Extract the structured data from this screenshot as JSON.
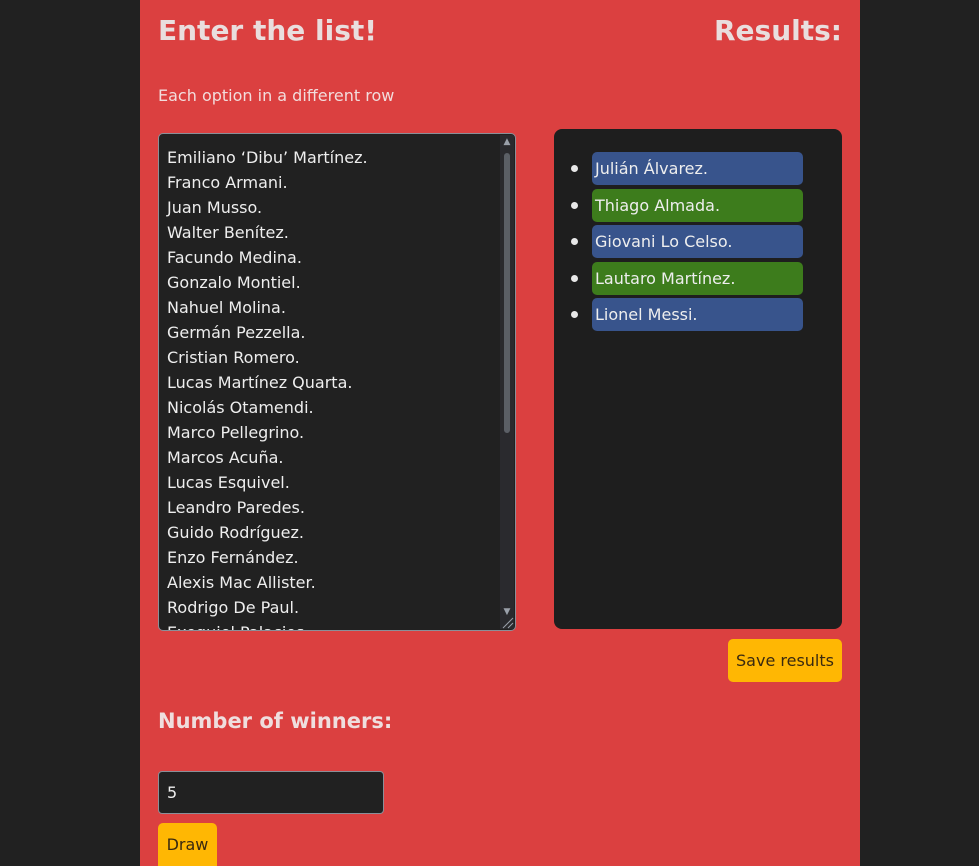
{
  "header": {
    "title": "Enter the list!",
    "results_title": "Results:"
  },
  "hint": "Each option in a different row",
  "options_list": [
    "Emiliano ‘Dibu’ Martínez.",
    "Franco Armani.",
    "Juan Musso.",
    "Walter Benítez.",
    "Facundo Medina.",
    "Gonzalo Montiel.",
    "Nahuel Molina.",
    "Germán Pezzella.",
    "Cristian Romero.",
    "Lucas Martínez Quarta.",
    "Nicolás Otamendi.",
    "Marco Pellegrino.",
    "Marcos Acuña.",
    "Lucas Esquivel.",
    "Leandro Paredes.",
    "Guido Rodríguez.",
    "Enzo Fernández.",
    "Alexis Mac Allister.",
    "Rodrigo De Paul.",
    "Exequiel Palacios."
  ],
  "results": [
    {
      "label": "Julián Álvarez.",
      "color": "#38548c"
    },
    {
      "label": "Thiago Almada.",
      "color": "#3d7c1c"
    },
    {
      "label": "Giovani Lo Celso.",
      "color": "#38548c"
    },
    {
      "label": "Lautaro Martínez.",
      "color": "#3d7c1c"
    },
    {
      "label": "Lionel Messi.",
      "color": "#38548c"
    }
  ],
  "save_button": "Save results",
  "winners": {
    "label": "Number of winners:",
    "value": "5"
  },
  "draw_button": "Draw",
  "colors": {
    "background": "#212121",
    "panel": "#db4040",
    "accent_button": "#ffb703",
    "chip_blue": "#38548c",
    "chip_green": "#3d7c1c"
  }
}
